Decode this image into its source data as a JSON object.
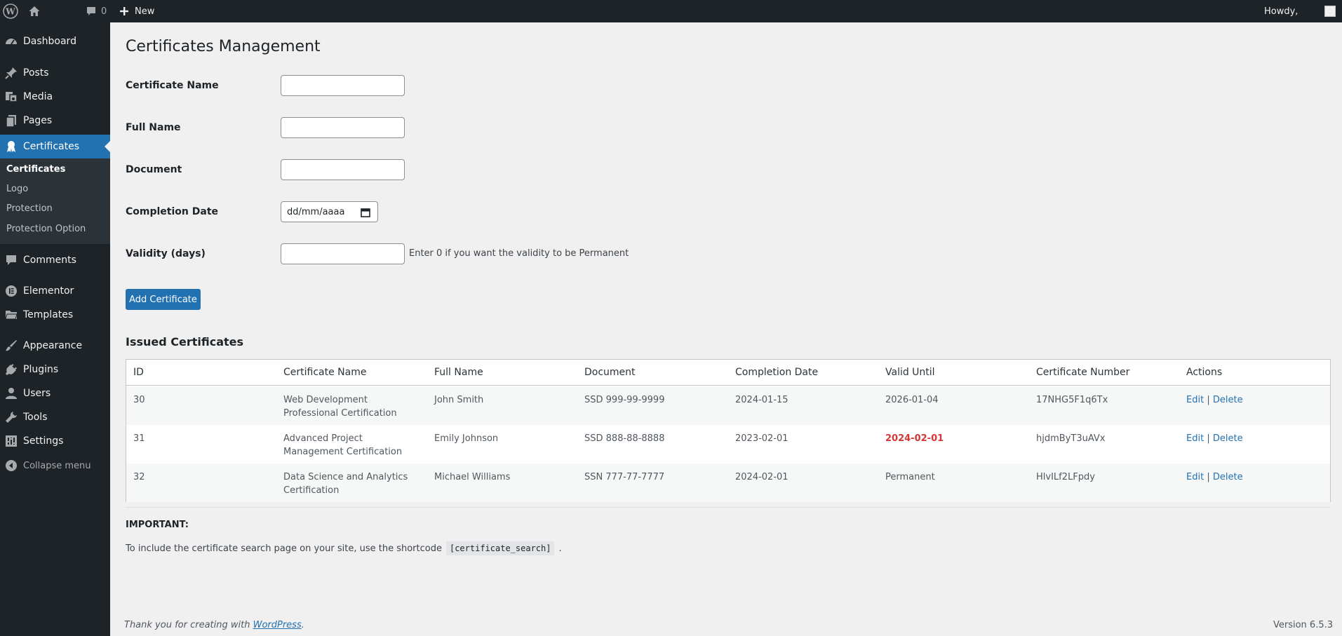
{
  "adminbar": {
    "comments_count": "0",
    "new_label": "New",
    "howdy": "Howdy,"
  },
  "sidebar": {
    "items": [
      {
        "label": "Dashboard",
        "icon": "dashboard-icon"
      },
      {
        "label": "Posts",
        "icon": "pin-icon"
      },
      {
        "label": "Media",
        "icon": "media-icon"
      },
      {
        "label": "Pages",
        "icon": "pages-icon"
      },
      {
        "label": "Certificates",
        "icon": "award-icon"
      },
      {
        "label": "Comments",
        "icon": "comment-icon"
      },
      {
        "label": "Elementor",
        "icon": "elementor-icon"
      },
      {
        "label": "Templates",
        "icon": "folder-icon"
      },
      {
        "label": "Appearance",
        "icon": "brush-icon"
      },
      {
        "label": "Plugins",
        "icon": "plug-icon"
      },
      {
        "label": "Users",
        "icon": "user-icon"
      },
      {
        "label": "Tools",
        "icon": "wrench-icon"
      },
      {
        "label": "Settings",
        "icon": "settings-icon"
      }
    ],
    "submenu": [
      "Certificates",
      "Logo",
      "Protection",
      "Protection Option"
    ],
    "collapse_label": "Collapse menu"
  },
  "page": {
    "title": "Certificates Management",
    "form": {
      "certificate_name_label": "Certificate Name",
      "certificate_name_value": "",
      "full_name_label": "Full Name",
      "full_name_value": "",
      "document_label": "Document",
      "document_value": "",
      "completion_date_label": "Completion Date",
      "completion_date_placeholder": "dd/mm/aaaa",
      "validity_label": "Validity (days)",
      "validity_value": "",
      "validity_hint": "Enter 0 if you want the validity to be Permanent",
      "submit_label": "Add Certificate"
    },
    "issued_title": "Issued Certificates",
    "table": {
      "headers": [
        "ID",
        "Certificate Name",
        "Full Name",
        "Document",
        "Completion Date",
        "Valid Until",
        "Certificate Number",
        "Actions"
      ],
      "rows": [
        {
          "id": "30",
          "certificate_name": "Web Development Professional Certification",
          "full_name": "John Smith",
          "document": "SSD 999-99-9999",
          "completion_date": "2024-01-15",
          "valid_until": "2026-01-04",
          "certificate_number": "17NHG5F1q6Tx",
          "edit": "Edit",
          "sep": "|",
          "delete": "Delete"
        },
        {
          "id": "31",
          "certificate_name": "Advanced Project Management Certification",
          "full_name": "Emily Johnson",
          "document": "SSD 888-88-8888",
          "completion_date": "2023-02-01",
          "valid_until": "2024-02-01",
          "certificate_number": "hjdmByT3uAVx",
          "edit": "Edit",
          "sep": "|",
          "delete": "Delete"
        },
        {
          "id": "32",
          "certificate_name": "Data Science and Analytics Certification",
          "full_name": "Michael Williams",
          "document": "SSN 777-77-7777",
          "completion_date": "2024-02-01",
          "valid_until": "Permanent",
          "certificate_number": "HlvILf2LFpdy",
          "edit": "Edit",
          "sep": "|",
          "delete": "Delete"
        }
      ]
    },
    "important_label": "IMPORTANT:",
    "note_prefix": "To include the certificate search page on your site, use the shortcode",
    "shortcode": "[certificate_search]",
    "note_suffix": "."
  },
  "footer": {
    "thanks_prefix": "Thank you for creating with",
    "wordpress_link": "WordPress",
    "thanks_suffix": ".",
    "version": "Version 6.5.3"
  },
  "colors": {
    "accent": "#2271b1",
    "sidebar_bg": "#1d2327",
    "expired": "#d63638"
  }
}
